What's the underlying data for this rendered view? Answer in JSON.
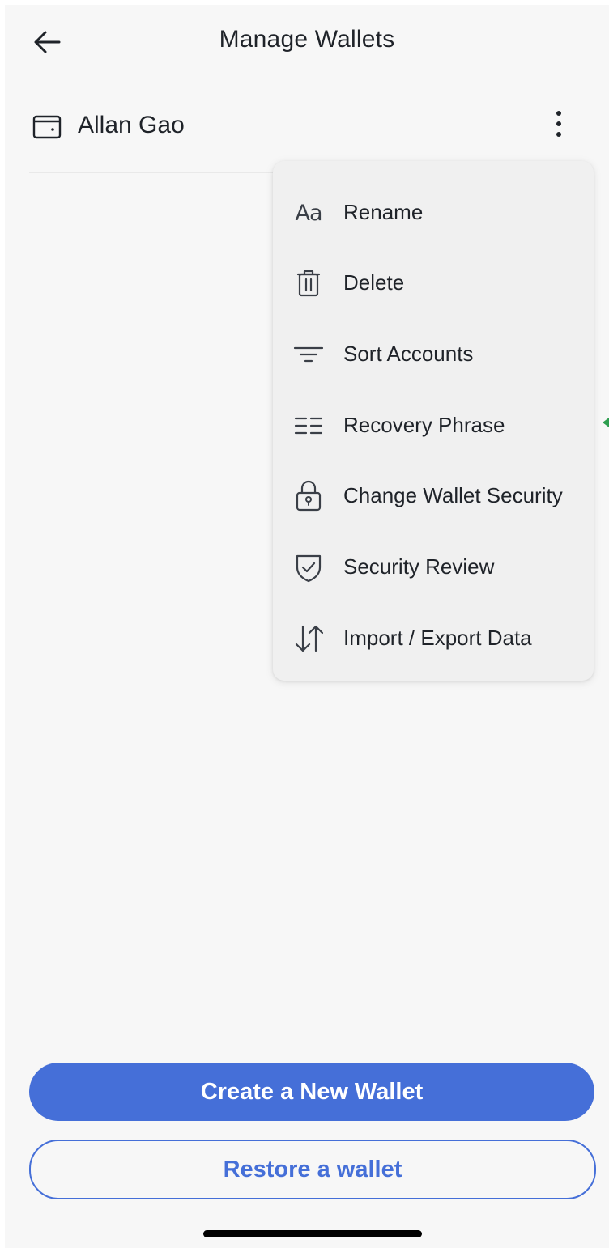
{
  "header": {
    "title": "Manage Wallets",
    "back_icon": "arrow-left-icon"
  },
  "wallet": {
    "name": "Allan Gao",
    "icon": "wallet-icon",
    "more_icon": "more-vertical-icon"
  },
  "menu": {
    "items": [
      {
        "label": "Rename",
        "icon": "text-aa-icon"
      },
      {
        "label": "Delete",
        "icon": "trash-icon"
      },
      {
        "label": "Sort Accounts",
        "icon": "sort-lines-icon"
      },
      {
        "label": "Recovery Phrase",
        "icon": "list-lines-icon"
      },
      {
        "label": "Change Wallet Security",
        "icon": "lock-icon"
      },
      {
        "label": "Security Review",
        "icon": "shield-check-icon"
      },
      {
        "label": "Import / Export Data",
        "icon": "arrows-updown-icon"
      }
    ],
    "aa_glyph": "Aa"
  },
  "actions": {
    "create_label": "Create a New Wallet",
    "restore_label": "Restore a wallet"
  },
  "colors": {
    "accent": "#456fd8",
    "background": "#f7f7f7",
    "menu_background": "#f0f0f0",
    "text": "#1f2329",
    "edge_marker": "#2e9e4f"
  }
}
